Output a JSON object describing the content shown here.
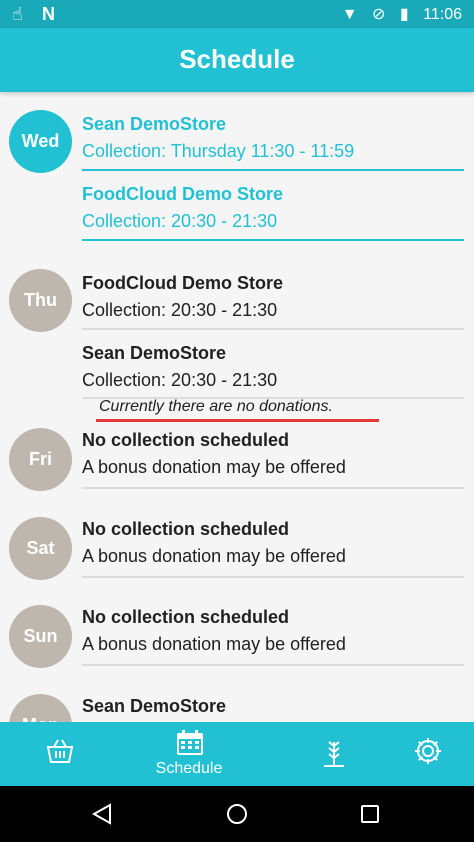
{
  "status_bar": {
    "left_icons": [
      "hand-pointer-icon",
      "n-app-icon"
    ],
    "n_glyph": "N",
    "right_icons": [
      "wifi-icon",
      "no-sim-icon",
      "battery-icon"
    ],
    "time": "11:06"
  },
  "app_bar": {
    "title": "Schedule"
  },
  "days": [
    {
      "day": "Wed",
      "today": true,
      "entries": [
        {
          "name": "Sean DemoStore",
          "detail": "Collection: Thursday 11:30 - 11:59"
        },
        {
          "name": "FoodCloud Demo Store",
          "detail": "Collection: 20:30 - 21:30"
        }
      ]
    },
    {
      "day": "Thu",
      "today": false,
      "entries": [
        {
          "name": "FoodCloud Demo Store",
          "detail": "Collection: 20:30 - 21:30"
        },
        {
          "name": "Sean DemoStore",
          "detail": "Collection: 20:30 - 21:30"
        }
      ],
      "notice": "Currently there are no donations."
    },
    {
      "day": "Fri",
      "today": false,
      "entries": [
        {
          "name": "No collection scheduled",
          "detail": "A bonus donation may be offered"
        }
      ]
    },
    {
      "day": "Sat",
      "today": false,
      "entries": [
        {
          "name": "No collection scheduled",
          "detail": "A bonus donation may be offered"
        }
      ]
    },
    {
      "day": "Sun",
      "today": false,
      "entries": [
        {
          "name": "No collection scheduled",
          "detail": "A bonus donation may be offered"
        }
      ]
    },
    {
      "day": "Mon",
      "today": false,
      "entries": [
        {
          "name": "Sean DemoStore",
          "detail": ""
        }
      ]
    }
  ],
  "bottom_nav": {
    "items": [
      {
        "icon": "basket-icon",
        "label": ""
      },
      {
        "icon": "calendar-icon",
        "label": "Schedule",
        "active": true
      },
      {
        "icon": "wheat-icon",
        "label": ""
      },
      {
        "icon": "gear-icon",
        "label": ""
      }
    ]
  },
  "colors": {
    "primary": "#21c1d3",
    "status_bar": "#1aa9b8",
    "inactive_day": "#bdb7ad",
    "notice_underline": "#e53935",
    "text": "#212121"
  }
}
